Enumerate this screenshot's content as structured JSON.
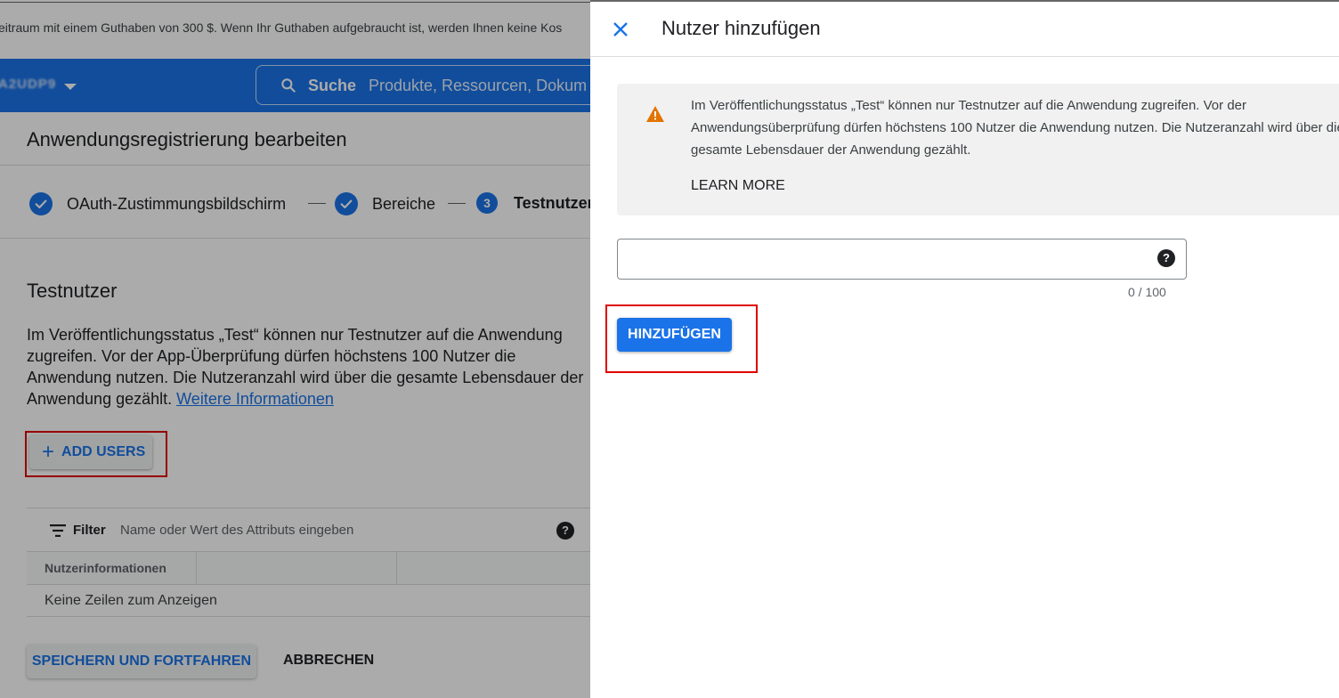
{
  "trial_banner": {
    "text": "eitraum mit einem Guthaben von 300 $. Wenn Ihr Guthaben aufgebraucht ist, werden Ihnen keine Kos"
  },
  "topbar": {
    "project_name": "A2UDP9",
    "search_label": "Suche",
    "search_placeholder": "Produkte, Ressourcen, Dokum"
  },
  "page": {
    "title": "Anwendungsregistrierung bearbeiten",
    "steps": [
      {
        "label": "OAuth-Zustimmungsbildschirm",
        "state": "done"
      },
      {
        "label": "Bereiche",
        "state": "done"
      },
      {
        "number": "3",
        "label": "Testnutzer",
        "state": "current"
      }
    ],
    "section_title": "Testnutzer",
    "description": "Im Veröffentlichungsstatus „Test“ können nur Testnutzer auf die Anwendung zugreifen. Vor der App-Überprüfung dürfen höchstens 100 Nutzer die Anwendung nutzen. Die Nutzeranzahl wird über die gesamte Lebensdauer der Anwendung gezählt.",
    "more_info_link": "Weitere Informationen",
    "add_users_label": "ADD USERS",
    "filter": {
      "label": "Filter",
      "placeholder": "Name oder Wert des Attributs eingeben"
    },
    "table": {
      "columns": [
        "Nutzerinformationen"
      ],
      "empty_text": "Keine Zeilen zum Anzeigen"
    },
    "save_label": "SPEICHERN UND FORTFAHREN",
    "cancel_label": "ABBRECHEN"
  },
  "panel": {
    "title": "Nutzer hinzufügen",
    "warning_text": "Im Veröffentlichungsstatus „Test“ können nur Testnutzer auf die Anwendung zugreifen. Vor der Anwendungsüberprüfung dürfen höchstens 100 Nutzer die Anwendung nutzen. Die Nutzeranzahl wird über die gesamte Lebensdauer der Anwendung gezählt.",
    "learn_more": "LEARN MORE",
    "email_value": "",
    "counter": "0 / 100",
    "add_label": "HINZUFÜGEN"
  },
  "colors": {
    "primary": "#1a73e8",
    "warning": "#e37400",
    "highlight": "#e00000"
  }
}
